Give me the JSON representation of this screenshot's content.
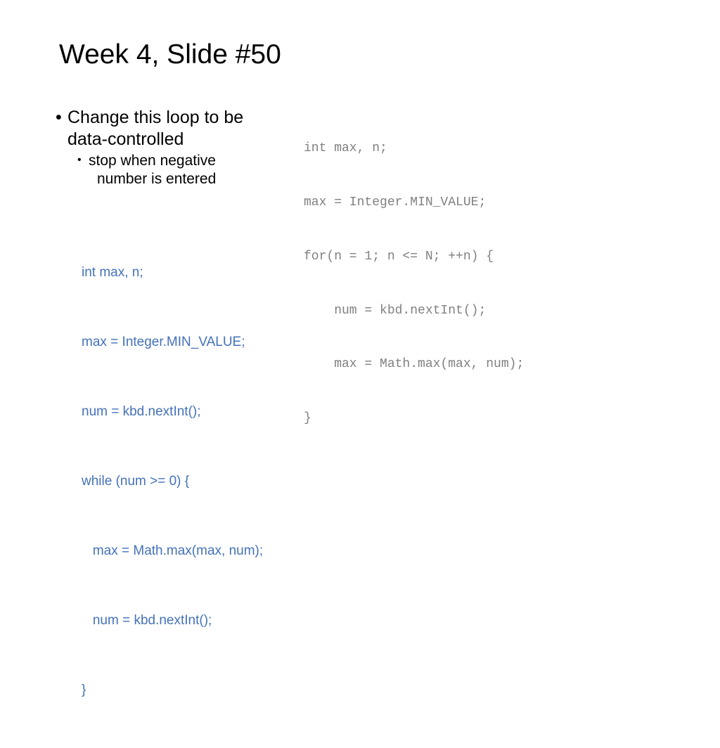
{
  "slide": {
    "title": "Week 4, Slide #50",
    "bullets": {
      "level1": {
        "marker": "•",
        "text": "Change this loop to be data-controlled"
      },
      "level2": {
        "marker": "•",
        "line1": "stop when negative",
        "line2": "number is entered"
      }
    },
    "code_blue": {
      "color": "#4472B8",
      "lines": [
        "int max, n;",
        "max = Integer.MIN_VALUE;",
        "num = kbd.nextInt();",
        "while (num >= 0) {",
        "   max = Math.max(max, num);",
        "   num = kbd.nextInt();",
        "}"
      ]
    },
    "code_mono": {
      "color": "#808080",
      "lines": [
        "int max, n;",
        "max = Integer.MIN_VALUE;",
        "for(n = 1; n <= N; ++n) {",
        "    num = kbd.nextInt();",
        "    max = Math.max(max, num);",
        "}"
      ]
    }
  }
}
